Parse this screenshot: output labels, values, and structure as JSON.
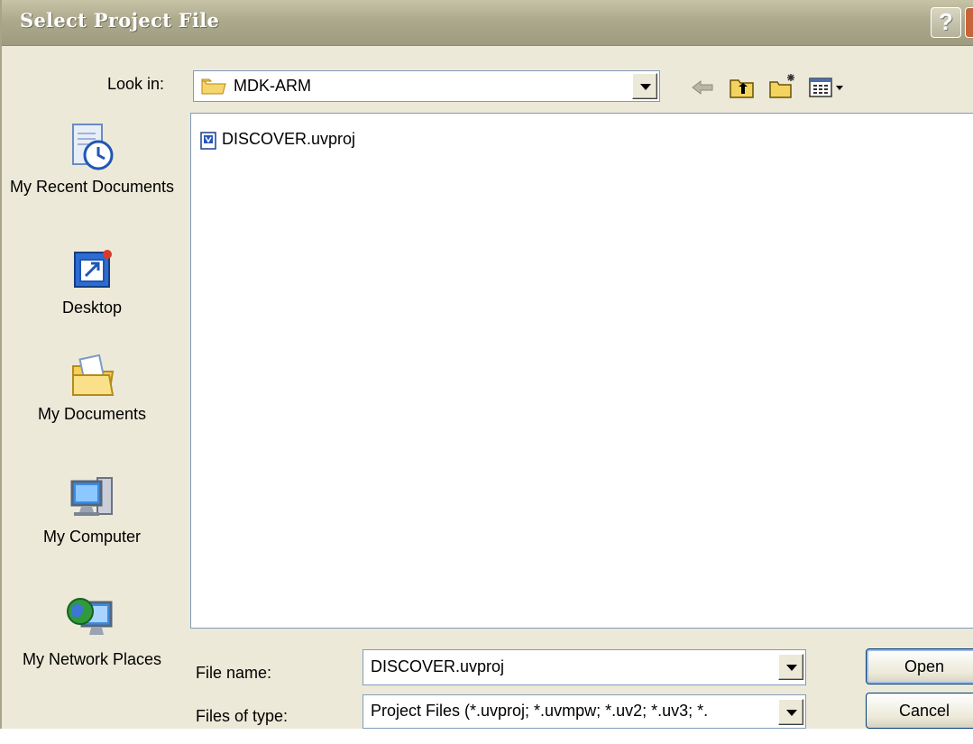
{
  "window": {
    "title": "Select Project File",
    "help_glyph": "?"
  },
  "toolbar": {
    "look_in_label": "Look in:",
    "look_in_value": "MDK-ARM",
    "icons": [
      "back-icon",
      "up-one-level-icon",
      "new-folder-icon",
      "views-menu-icon"
    ]
  },
  "places": [
    {
      "label": "My Recent Documents",
      "icon": "recent-documents-icon"
    },
    {
      "label": "Desktop",
      "icon": "desktop-icon"
    },
    {
      "label": "My Documents",
      "icon": "my-documents-icon"
    },
    {
      "label": "My Computer",
      "icon": "my-computer-icon"
    },
    {
      "label": "My Network Places",
      "icon": "network-places-icon"
    }
  ],
  "files": [
    {
      "name": "DISCOVER.uvproj",
      "icon": "uvision-project-icon"
    }
  ],
  "form": {
    "file_name_label": "File name:",
    "file_name_value": "DISCOVER.uvproj",
    "files_of_type_label": "Files of type:",
    "files_of_type_value": "Project Files (*.uvproj; *.uvmpw; *.uv2; *.uv3; *."
  },
  "buttons": {
    "open": "Open",
    "cancel": "Cancel"
  },
  "colors": {
    "title_bar": "#aca98d",
    "dialog_bg": "#ece9d8",
    "border_blue": "#7f9db9"
  }
}
